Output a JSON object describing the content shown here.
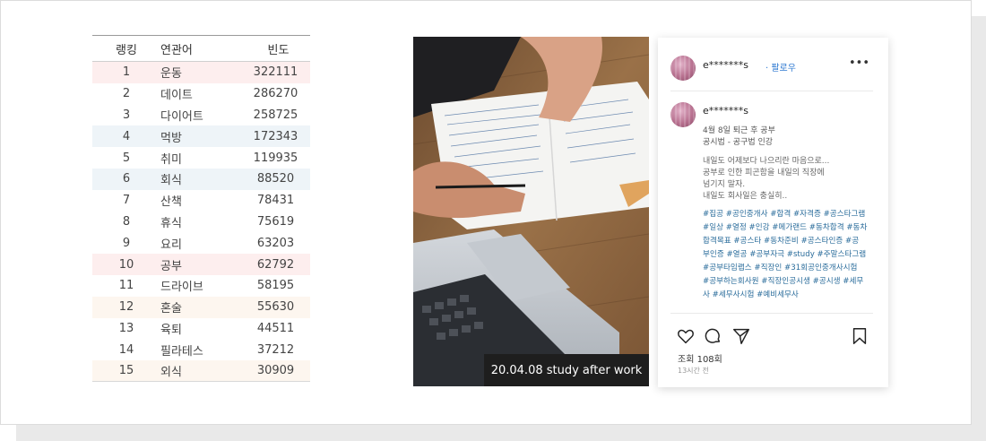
{
  "ranking": {
    "headers": {
      "rank": "랭킹",
      "word": "연관어",
      "freq": "빈도"
    },
    "rows": [
      {
        "rank": "1",
        "word": "운동",
        "freq": "322111",
        "highlight": "#fdeeee"
      },
      {
        "rank": "2",
        "word": "데이트",
        "freq": "286270",
        "highlight": ""
      },
      {
        "rank": "3",
        "word": "다이어트",
        "freq": "258725",
        "highlight": ""
      },
      {
        "rank": "4",
        "word": "먹방",
        "freq": "172343",
        "highlight": "#eef4f8"
      },
      {
        "rank": "5",
        "word": "취미",
        "freq": "119935",
        "highlight": ""
      },
      {
        "rank": "6",
        "word": "회식",
        "freq": "88520",
        "highlight": "#eef4f8"
      },
      {
        "rank": "7",
        "word": "산책",
        "freq": "78431",
        "highlight": ""
      },
      {
        "rank": "8",
        "word": "휴식",
        "freq": "75619",
        "highlight": ""
      },
      {
        "rank": "9",
        "word": "요리",
        "freq": "63203",
        "highlight": ""
      },
      {
        "rank": "10",
        "word": "공부",
        "freq": "62792",
        "highlight": "#fdeeee"
      },
      {
        "rank": "11",
        "word": "드라이브",
        "freq": "58195",
        "highlight": ""
      },
      {
        "rank": "12",
        "word": "혼술",
        "freq": "55630",
        "highlight": "#fdf6ef"
      },
      {
        "rank": "13",
        "word": "육퇴",
        "freq": "44511",
        "highlight": ""
      },
      {
        "rank": "14",
        "word": "필라테스",
        "freq": "37212",
        "highlight": ""
      },
      {
        "rank": "15",
        "word": "외식",
        "freq": "30909",
        "highlight": "#fdf6ef"
      }
    ]
  },
  "photo": {
    "caption": "20.04.08 study after work"
  },
  "post": {
    "header": {
      "username": "e*******s",
      "follow_label": "팔로우",
      "more_icon": "more-dots-icon"
    },
    "body": {
      "username": "e*******s",
      "meta": [
        "4월 8일 퇴근 후 공부",
        "공시법 - 공구법 인강"
      ],
      "caption": [
        "내일도 어제보다 나으리란 마음으로...",
        "공부로 인한 피곤함을 내일의 직장에",
        "넘기지 말자.",
        "내일도 회사일은 충실히.."
      ],
      "tags": [
        "#집공 #공인중개사 #합격 #자격증 #공스타그램",
        "#일상 #열정 #인강 #메가랜드 #동차합격 #동차",
        "합격목표 #공스타 #동차준비 #공스타인증 #공",
        "부인증 #열공 #공부자극 #study #주말스타그램",
        "#공부타임랩스 #직장인 #31회공인중개사시험",
        "#공부하는회사원 #직장인공시생 #공시생 #세무",
        "사 #세무사시험 #예비세무사"
      ]
    },
    "actions": {
      "icons": [
        "heart-icon",
        "comment-icon",
        "share-icon",
        "bookmark-icon"
      ],
      "views": "조회 108회",
      "time": "13시간 전"
    }
  }
}
